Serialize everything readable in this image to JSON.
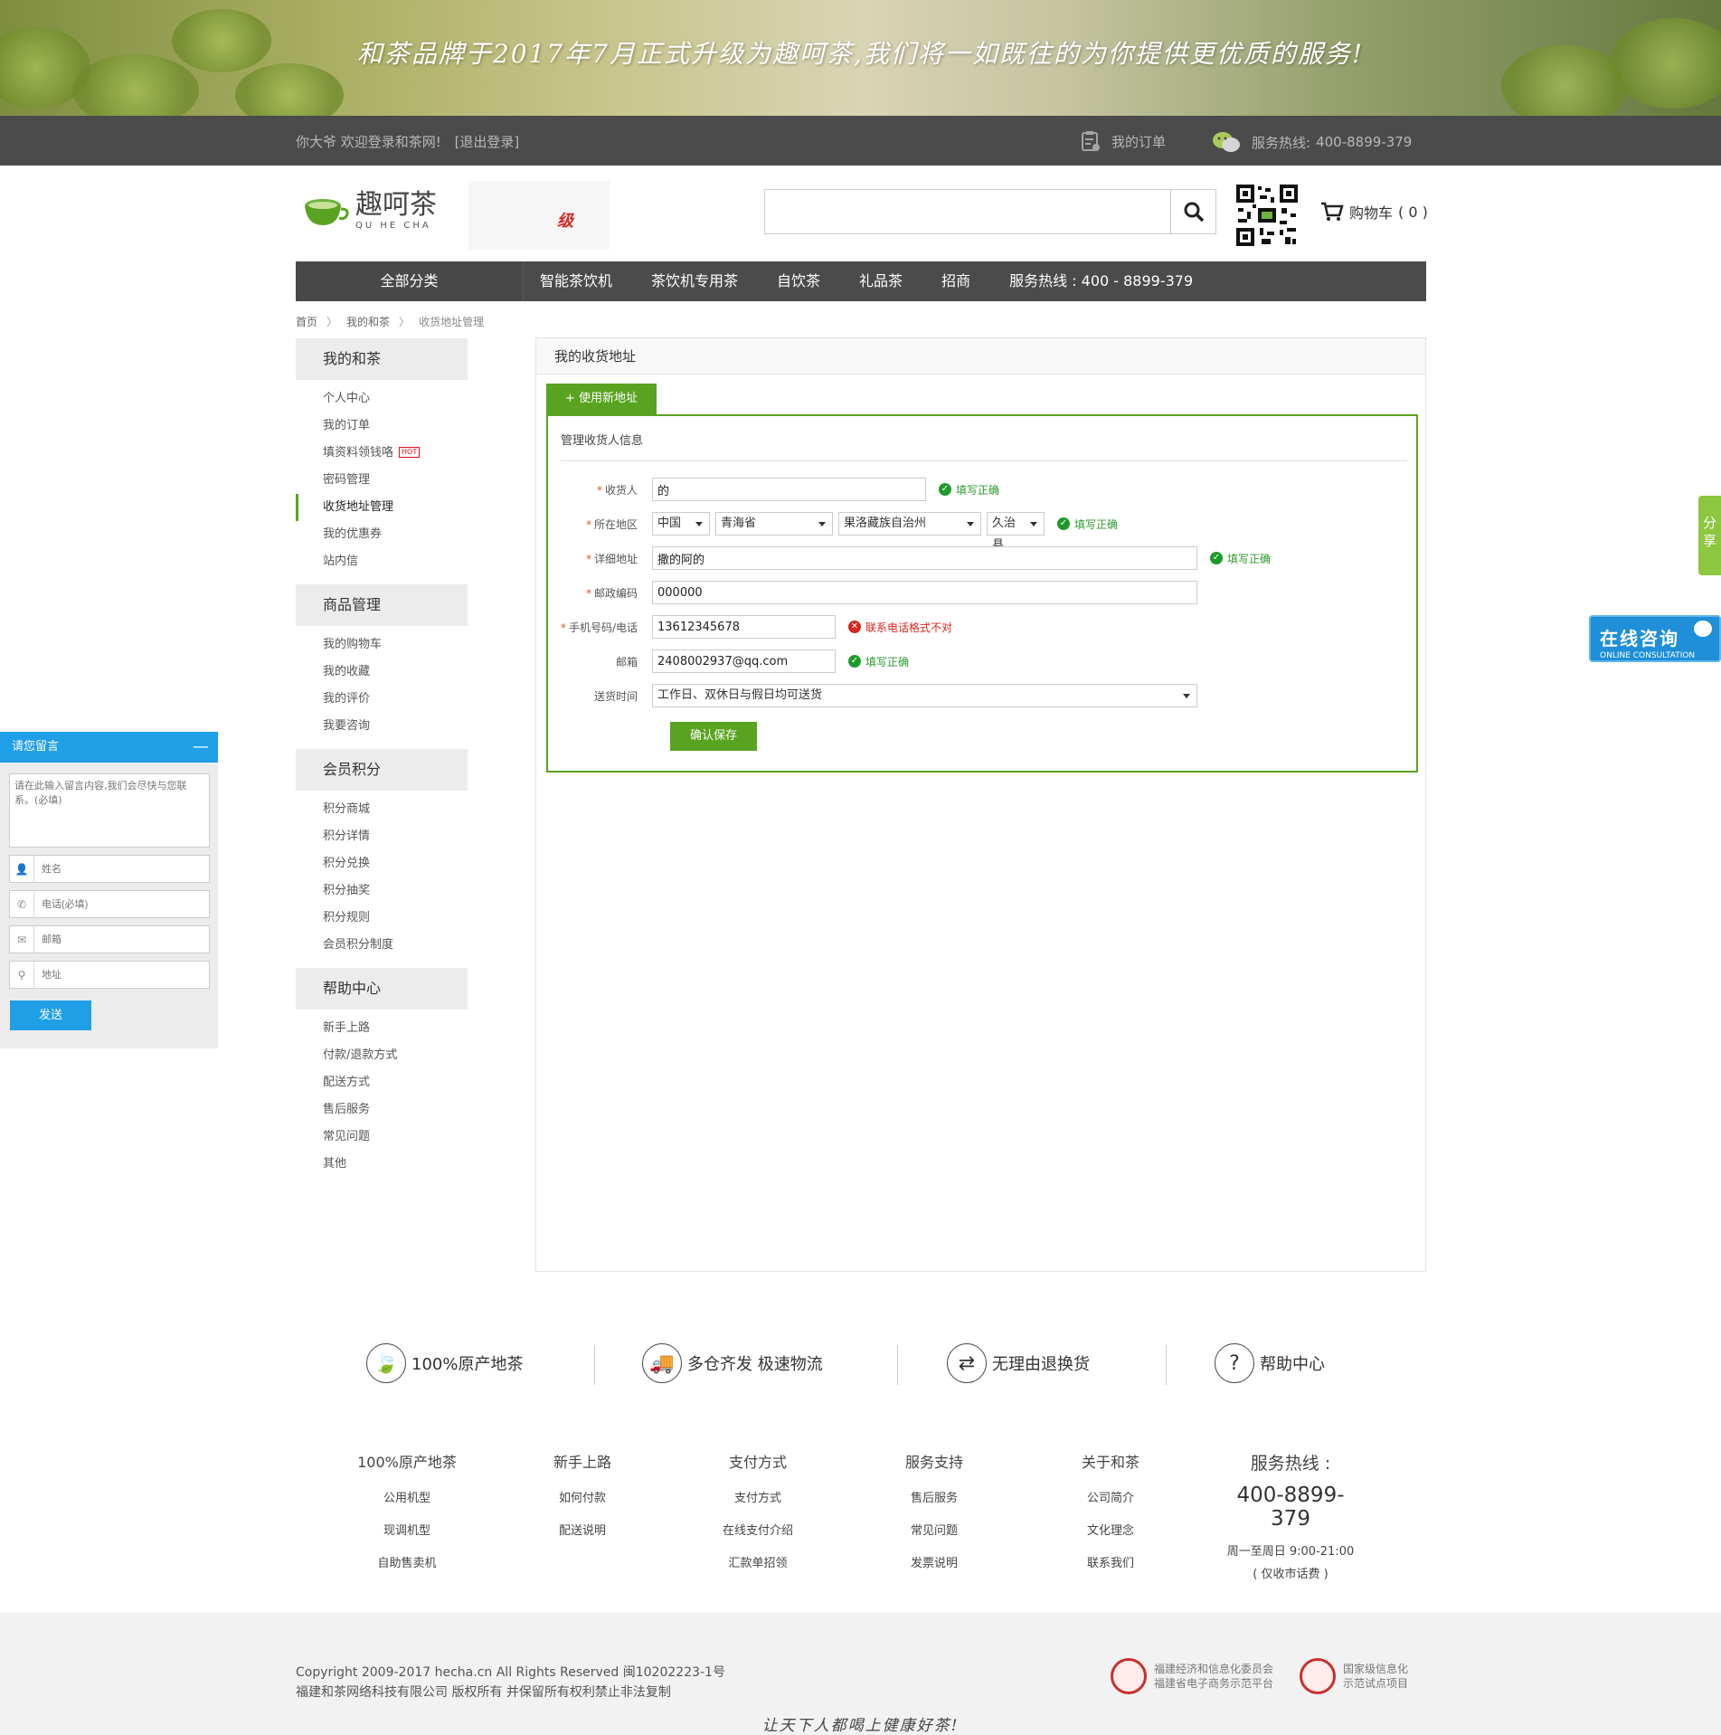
{
  "banner": {
    "text": "和茶品牌于2017年7月正式升级为趣呵茶,我们将一如既往的为你提供更优质的服务!"
  },
  "topbar": {
    "welcome": "你大爷 欢迎登录和茶网!",
    "logout": "[退出登录]",
    "my_orders": "我的订单",
    "hotline_label": "服务热线:",
    "hotline_number": "400-8899-379"
  },
  "header": {
    "brand": "趣呵茶",
    "brand_en": "QU HE CHA",
    "promo_text": "级",
    "search_placeholder": "",
    "cart_label": "购物车",
    "cart_count": "( 0 )"
  },
  "nav": {
    "all_categories": "全部分类",
    "items": [
      "智能茶饮机",
      "茶饮机专用茶",
      "自饮茶",
      "礼品茶",
      "招商",
      "服务热线 : 400 - 8899-379"
    ]
  },
  "breadcrumb": [
    "首页",
    "我的和茶",
    "收货地址管理"
  ],
  "sidebar": {
    "groups": [
      {
        "title": "我的和茶",
        "items": [
          "个人中心",
          "我的订单",
          "填资料领钱咯",
          "密码管理",
          "收货地址管理",
          "我的优惠券",
          "站内信"
        ]
      },
      {
        "title": "商品管理",
        "items": [
          "我的购物车",
          "我的收藏",
          "我的评价",
          "我要咨询"
        ]
      },
      {
        "title": "会员积分",
        "items": [
          "积分商城",
          "积分详情",
          "积分兑换",
          "积分抽奖",
          "积分规则",
          "会员积分制度"
        ]
      },
      {
        "title": "帮助中心",
        "items": [
          "新手上路",
          "付款/退款方式",
          "配送方式",
          "售后服务",
          "常见问题",
          "其他"
        ]
      }
    ],
    "hot_badge": "HOT"
  },
  "main": {
    "title": "我的收货地址",
    "new_address_tab": "+ 使用新地址",
    "form_title": "管理收货人信息",
    "fields": {
      "receiver": {
        "label": "收货人",
        "value": "的",
        "status": "填写正确"
      },
      "region": {
        "label": "所在地区",
        "country": "中国",
        "province": "青海省",
        "city": "果洛藏族自治州",
        "county": "久治县",
        "status": "填写正确"
      },
      "address": {
        "label": "详细地址",
        "value": "撒的阿的",
        "status": "填写正确"
      },
      "zipcode": {
        "label": "邮政编码",
        "value": "000000"
      },
      "phone": {
        "label": "手机号码/电话",
        "value": "13612345678",
        "status": "联系电话格式不对"
      },
      "email": {
        "label": "邮箱",
        "value": "2408002937@qq.com",
        "status": "填写正确"
      },
      "delivery_time": {
        "label": "送货时间",
        "value": "工作日、双休日与假日均可送货"
      }
    },
    "save_button": "确认保存"
  },
  "float": {
    "share": [
      "分",
      "享"
    ],
    "consult_title": "在线咨询",
    "consult_sub": "ONLINE CONSULTATION"
  },
  "message_widget": {
    "title": "请您留言",
    "minimize": "—",
    "textarea_placeholder": "请在此输入留言内容,我们会尽快与您联系。(必填)",
    "name_placeholder": "姓名",
    "phone_placeholder": "电话(必填)",
    "email_placeholder": "邮箱",
    "address_placeholder": "地址",
    "send": "发送"
  },
  "features": [
    "100%原产地茶",
    "多仓齐发 极速物流",
    "无理由退换货",
    "帮助中心"
  ],
  "footer": {
    "columns": [
      {
        "title": "100%原产地茶",
        "links": [
          "公用机型",
          "现调机型",
          "自助售卖机"
        ]
      },
      {
        "title": "新手上路",
        "links": [
          "如何付款",
          "配送说明"
        ]
      },
      {
        "title": "支付方式",
        "links": [
          "支付方式",
          "在线支付介绍",
          "汇款单招领"
        ]
      },
      {
        "title": "服务支持",
        "links": [
          "售后服务",
          "常见问题",
          "发票说明"
        ]
      },
      {
        "title": "关于和茶",
        "links": [
          "公司简介",
          "文化理念",
          "联系我们"
        ]
      }
    ],
    "hotline_title": "服务热线 :",
    "hotline_number": "400-8899-379",
    "hotline_hours": "周一至周日 9:00-21:00",
    "hotline_note": "( 仅收市话费 )",
    "copyright_1": "Copyright 2009-2017 hecha.cn All Rights Reserved 闽10202223-1号",
    "copyright_2": "福建和茶网络科技有限公司 版权所有 并保留所有权利禁止非法复制",
    "badge1_line1": "福建经济和信息化委员会",
    "badge1_line2": "福建省电子商务示范平台",
    "badge2_line1": "国家级信息化",
    "badge2_line2": "示范试点项目",
    "slogan": "让天下人都喝上健康好茶!"
  },
  "colors": {
    "accent_green": "#5aa320",
    "dark_bar": "#4b4b4b",
    "widget_blue": "#1f9fe6",
    "error_red": "#d9251c"
  }
}
